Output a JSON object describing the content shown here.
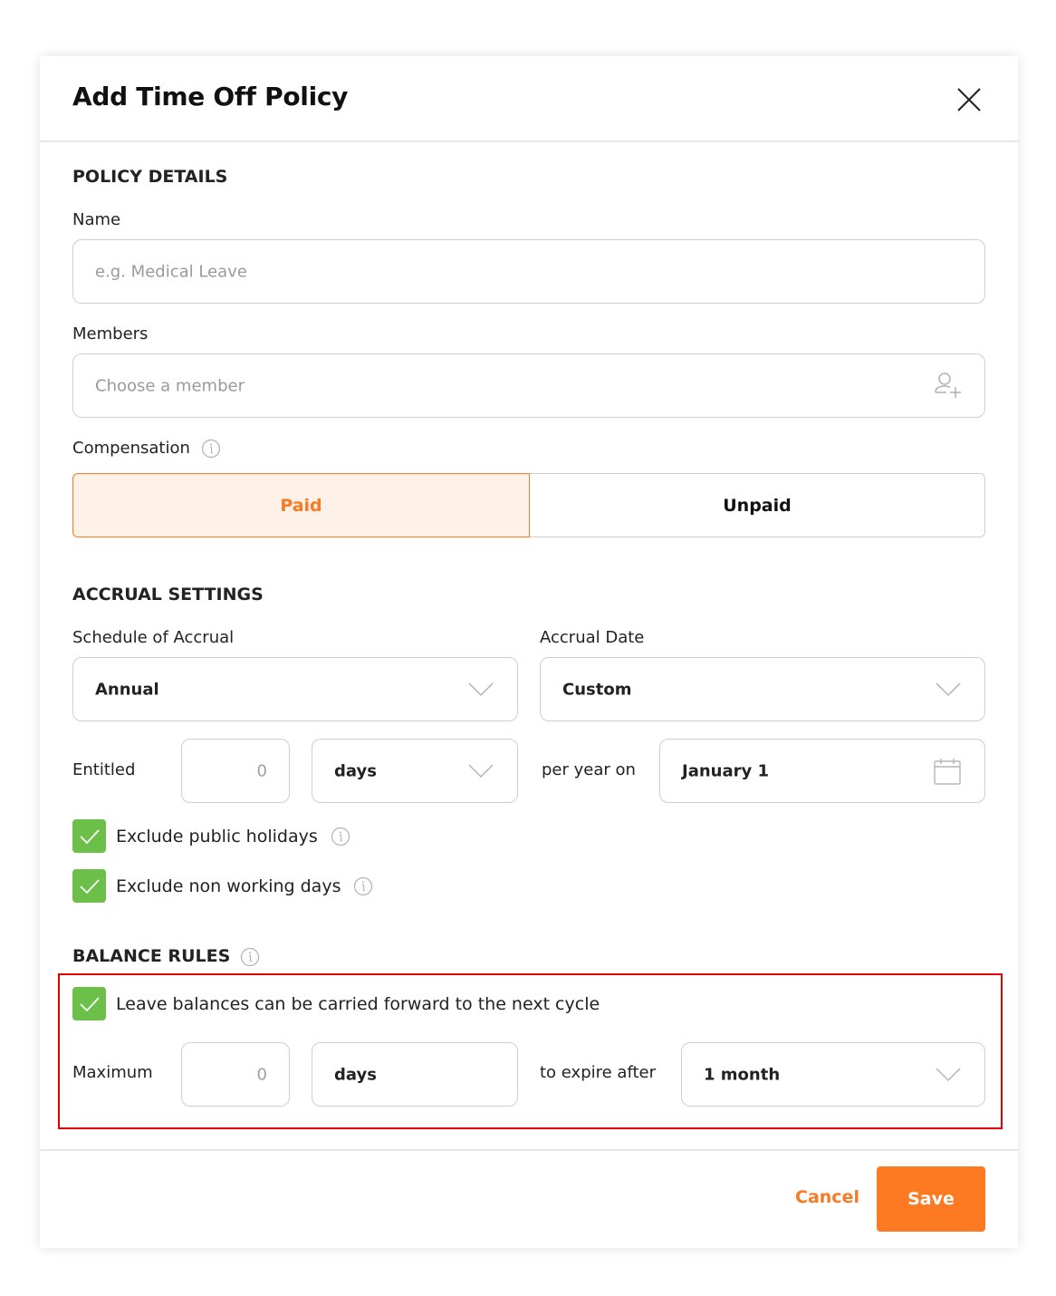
{
  "modal": {
    "title": "Add Time Off Policy"
  },
  "policy_details": {
    "section_title": "POLICY DETAILS",
    "name_label": "Name",
    "name_placeholder": "e.g. Medical Leave",
    "members_label": "Members",
    "members_placeholder": "Choose a member",
    "compensation_label": "Compensation",
    "compensation_options": [
      "Paid",
      "Unpaid"
    ],
    "compensation_selected": "Paid"
  },
  "accrual_settings": {
    "section_title": "ACCRUAL SETTINGS",
    "schedule_label": "Schedule of Accrual",
    "schedule_value": "Annual",
    "accrual_date_label": "Accrual Date",
    "accrual_date_value": "Custom",
    "entitled_label": "Entitled",
    "entitled_value": "0",
    "entitled_unit": "days",
    "per_year_label": "per year on",
    "date_value": "January 1",
    "exclude_holidays_label": "Exclude public holidays",
    "exclude_holidays_checked": true,
    "exclude_nonworking_label": "Exclude non working days",
    "exclude_nonworking_checked": true
  },
  "balance_rules": {
    "section_title": "BALANCE RULES",
    "carry_forward_label": "Leave balances can be carried forward to the next cycle",
    "carry_forward_checked": true,
    "maximum_label": "Maximum",
    "maximum_value": "0",
    "maximum_unit": "days",
    "expire_label": "to expire after",
    "expire_value": "1 month"
  },
  "footer": {
    "cancel_label": "Cancel",
    "save_label": "Save"
  },
  "colors": {
    "accent": "#f97a22",
    "checkbox_green": "#6cc04a",
    "highlight_red": "#e60000"
  }
}
